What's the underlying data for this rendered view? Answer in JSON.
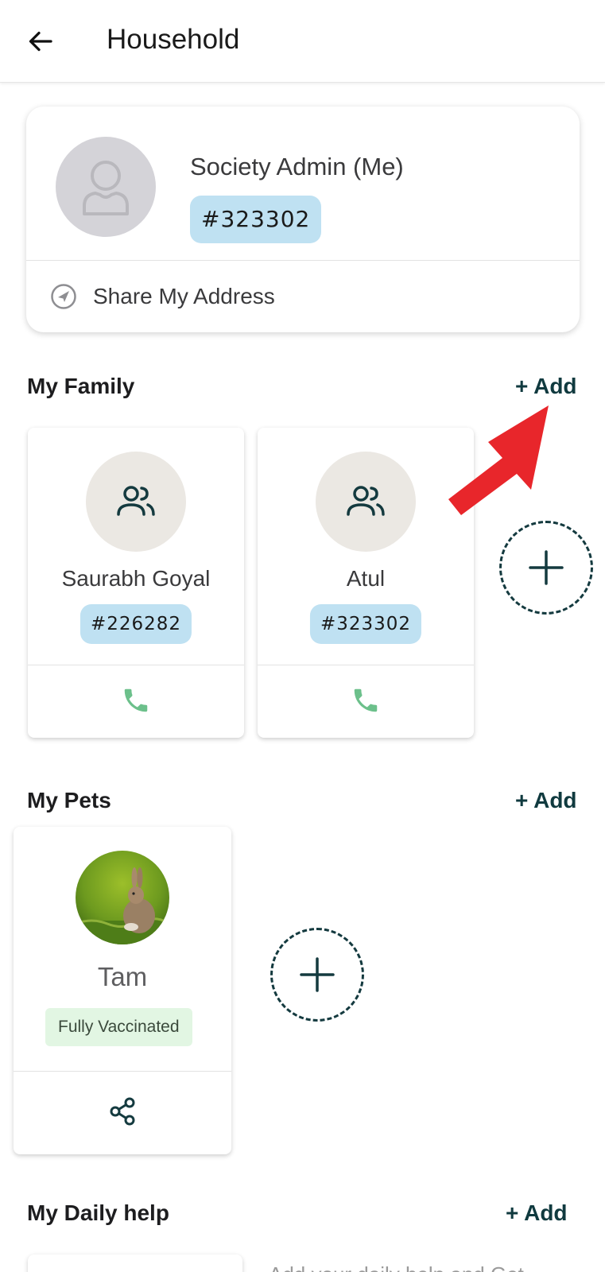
{
  "header": {
    "title": "Household"
  },
  "profile": {
    "name": "Society Admin (Me)",
    "id": "#323302",
    "share_label": "Share My Address"
  },
  "family": {
    "title": "My Family",
    "add_label": "+ Add",
    "members": [
      {
        "name": "Saurabh Goyal",
        "id": "#226282"
      },
      {
        "name": "Atul",
        "id": "#323302"
      }
    ]
  },
  "pets": {
    "title": "My Pets",
    "add_label": "+ Add",
    "items": [
      {
        "name": "Tam",
        "status": "Fully Vaccinated"
      }
    ]
  },
  "daily_help": {
    "title": "My Daily help",
    "add_label": "+ Add",
    "hint": "Add your daily help and Get"
  },
  "colors": {
    "accent": "#103a3f",
    "id_badge": "#bfe1f2",
    "call_green": "#6cc08b",
    "vaccinated_bg": "#e2f6e3",
    "annotation_red": "#e8262b"
  },
  "icons": {
    "back": "arrow-left-icon",
    "avatar": "user-placeholder-icon",
    "share_address": "navigation-icon",
    "member": "users-icon",
    "call": "phone-icon",
    "add": "plus-icon",
    "pet_share": "share-icon"
  }
}
